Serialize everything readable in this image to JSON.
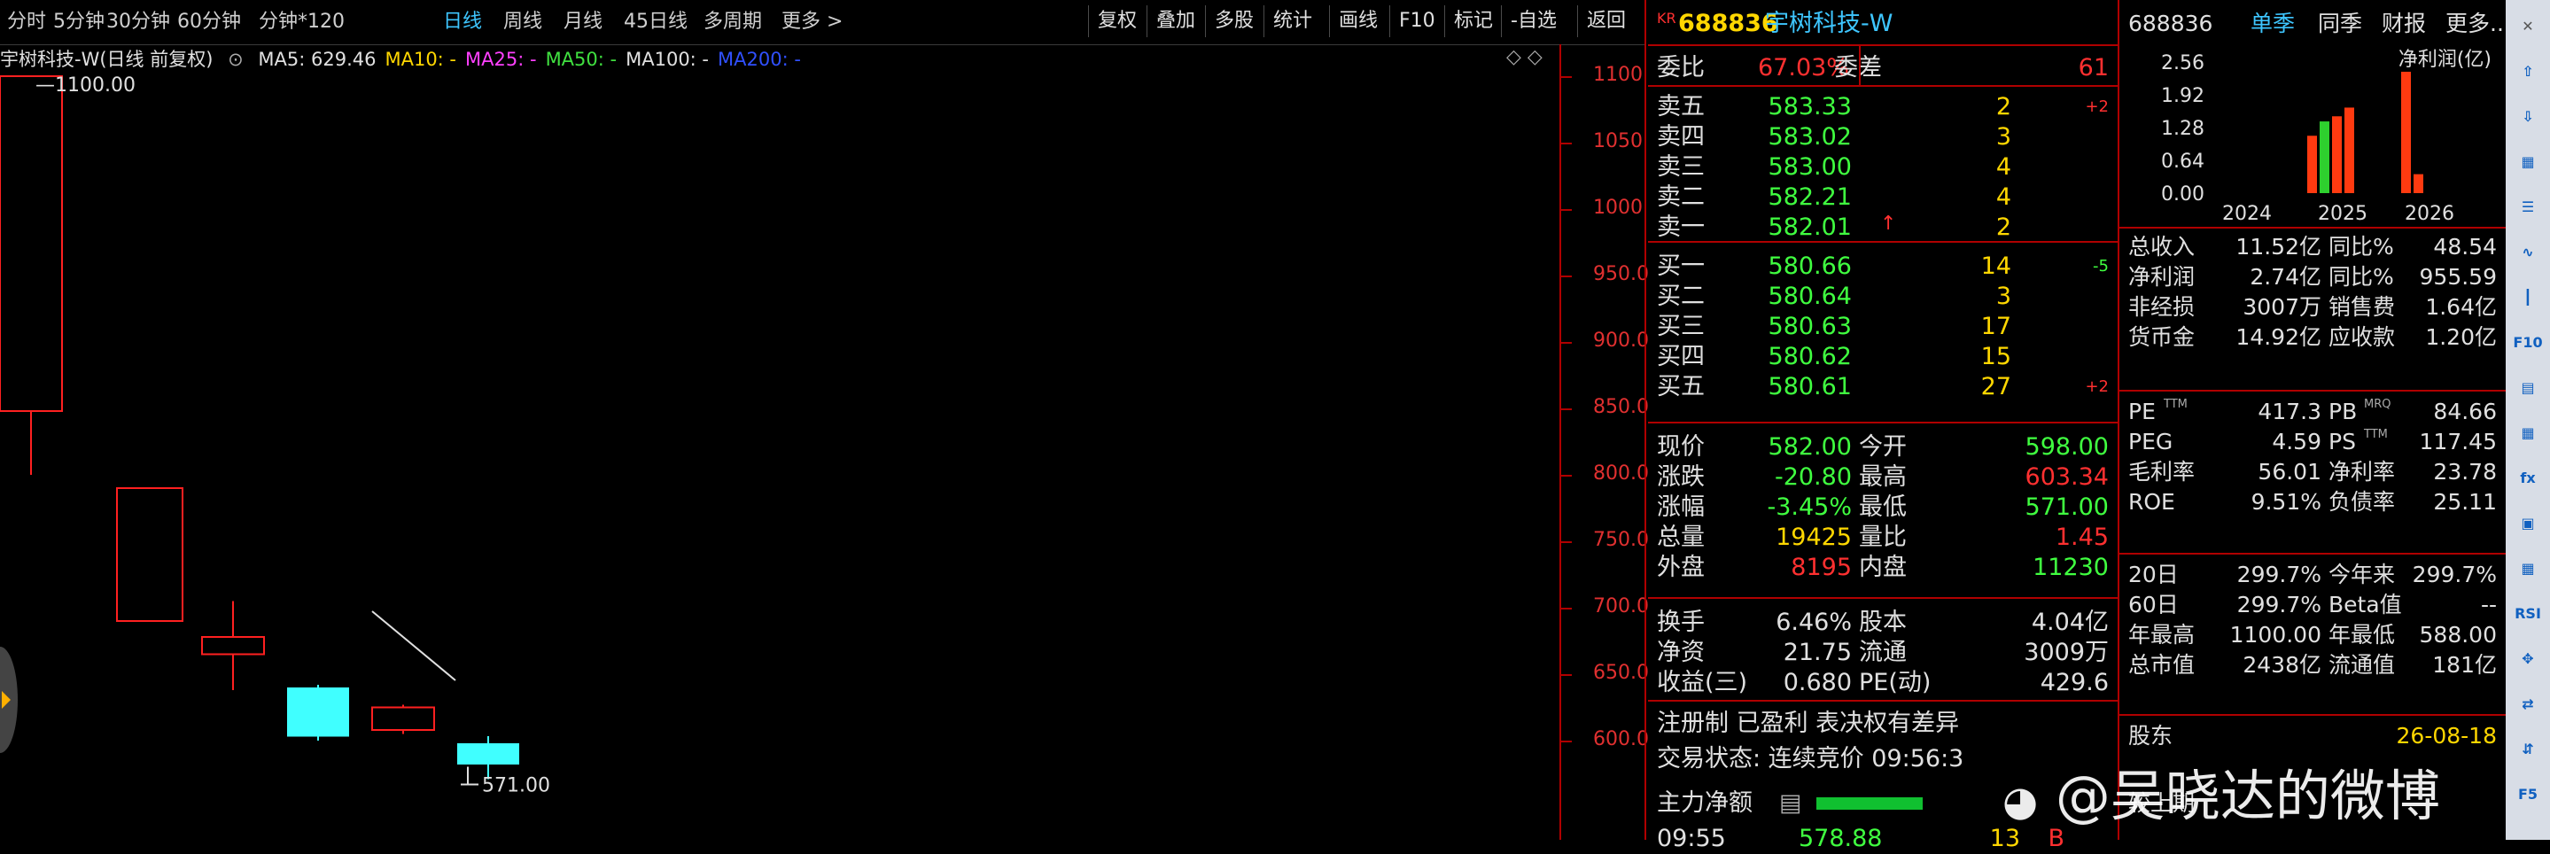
{
  "periods": [
    "分时",
    "5分钟",
    "30分钟",
    "60分钟",
    "分钟*120",
    "日线",
    "周线",
    "月线",
    "45日线",
    "多周期",
    "更多 >"
  ],
  "active_period": "日线",
  "tools": [
    "复权",
    "叠加",
    "多股",
    "统计",
    "画线",
    "F10",
    "标记",
    "-自选",
    "返回"
  ],
  "chart": {
    "title": "宇树科技-W(日线 前复权)",
    "ma": [
      {
        "label": "MA5: 629.46",
        "color": "#e0e0e0"
      },
      {
        "label": "MA10: -",
        "color": "#ffd700"
      },
      {
        "label": "MA25: -",
        "color": "#ff40ff"
      },
      {
        "label": "MA50: -",
        "color": "#40e040"
      },
      {
        "label": "MA100: -",
        "color": "#e0e0e0"
      },
      {
        "label": "MA200: -",
        "color": "#3050ff"
      }
    ],
    "high_label": "1100.00",
    "low_label": "571.00",
    "yticks": [
      "1100",
      "1050",
      "1000",
      "950.0",
      "900.0",
      "850.0",
      "800.0",
      "750.0",
      "700.0",
      "650.0",
      "600.0"
    ],
    "candles": [
      {
        "open": 848,
        "close": 1100,
        "high": 1100,
        "low": 800
      },
      {
        "open": 690,
        "close": 790,
        "high": 790,
        "low": 690
      },
      {
        "open": 665,
        "close": 678,
        "high": 705,
        "low": 638
      },
      {
        "open": 640,
        "close": 603,
        "high": 642,
        "low": 600
      },
      {
        "open": 608,
        "close": 625,
        "high": 627,
        "low": 605
      },
      {
        "open": 598,
        "close": 582,
        "high": 603.34,
        "low": 571
      }
    ]
  },
  "quote": {
    "badge": "KR",
    "code": "688836",
    "name": "宇树科技-W",
    "weibi_label": "委比",
    "weibi": "67.03%",
    "weicha_label": "委差",
    "weicha": "61",
    "sells": [
      {
        "label": "卖五",
        "price": "583.33",
        "vol": "2",
        "chg": "+2"
      },
      {
        "label": "卖四",
        "price": "583.02",
        "vol": "3",
        "chg": ""
      },
      {
        "label": "卖三",
        "price": "583.00",
        "vol": "4",
        "chg": ""
      },
      {
        "label": "卖二",
        "price": "582.21",
        "vol": "4",
        "chg": ""
      },
      {
        "label": "卖一",
        "price": "582.01",
        "vol": "2",
        "chg": ""
      }
    ],
    "buys": [
      {
        "label": "买一",
        "price": "580.66",
        "vol": "14",
        "chg": "-5"
      },
      {
        "label": "买二",
        "price": "580.64",
        "vol": "3",
        "chg": ""
      },
      {
        "label": "买三",
        "price": "580.63",
        "vol": "17",
        "chg": ""
      },
      {
        "label": "买四",
        "price": "580.62",
        "vol": "15",
        "chg": ""
      },
      {
        "label": "买五",
        "price": "580.61",
        "vol": "27",
        "chg": "+2"
      }
    ],
    "stats": [
      {
        "l1": "现价",
        "v1": "582.00",
        "c1": "#40ff40",
        "l2": "今开",
        "v2": "598.00",
        "c2": "#40ff40"
      },
      {
        "l1": "涨跌",
        "v1": "-20.80",
        "c1": "#40ff40",
        "l2": "最高",
        "v2": "603.34",
        "c2": "#ff3030"
      },
      {
        "l1": "涨幅",
        "v1": "-3.45%",
        "c1": "#40ff40",
        "l2": "最低",
        "v2": "571.00",
        "c2": "#40ff40"
      },
      {
        "l1": "总量",
        "v1": "19425",
        "c1": "#ffd700",
        "l2": "量比",
        "v2": "1.45",
        "c2": "#ff3030"
      },
      {
        "l1": "外盘",
        "v1": "8195",
        "c1": "#ff3030",
        "l2": "内盘",
        "v2": "11230",
        "c2": "#40ff40"
      }
    ],
    "stats2": [
      {
        "l1": "换手",
        "v1": "6.46%",
        "l2": "股本",
        "v2": "4.04亿"
      },
      {
        "l1": "净资",
        "v1": "21.75",
        "l2": "流通",
        "v2": "3009万"
      },
      {
        "l1": "收益(三)",
        "v1": "0.680",
        "l2": "PE(动)",
        "v2": "429.6"
      }
    ],
    "tags": "注册制 已盈利 表决权有差异",
    "trade_status": "交易状态: 连续竞价 09:56:3",
    "mainforce_label": "主力净额",
    "bottom_time": "09:55",
    "bottom_price": "578.88",
    "bottom_vol": "13",
    "bottom_flag": "B"
  },
  "fin": {
    "code": "688836",
    "tabs": [
      "单季",
      "同季",
      "财报",
      "更多.."
    ],
    "chart_title": "净利润(亿)",
    "yticks": [
      "2.56",
      "1.92",
      "1.28",
      "0.64",
      "0.00"
    ],
    "xticks": [
      "2024",
      "2025",
      "2026"
    ],
    "rows1": [
      {
        "l1": "总收入",
        "v1": "11.52亿",
        "l2": "同比%",
        "v2": "48.54"
      },
      {
        "l1": "净利润",
        "v1": "2.74亿",
        "l2": "同比%",
        "v2": "955.59"
      },
      {
        "l1": "非经损",
        "v1": "3007万",
        "l2": "销售费",
        "v2": "1.64亿"
      },
      {
        "l1": "货币金",
        "v1": "14.92亿",
        "l2": "应收款",
        "v2": "1.20亿"
      }
    ],
    "rows2": [
      {
        "l1": "PE",
        "s1": "TTM",
        "v1": "417.3",
        "l2": "PB",
        "s2": "MRQ",
        "v2": "84.66"
      },
      {
        "l1": "PEG",
        "s1": "",
        "v1": "4.59",
        "l2": "PS",
        "s2": "TTM",
        "v2": "117.45"
      },
      {
        "l1": "毛利率",
        "s1": "",
        "v1": "56.01",
        "l2": "净利率",
        "s2": "",
        "v2": "23.78"
      },
      {
        "l1": "ROE",
        "s1": "",
        "v1": "9.51%",
        "l2": "负债率",
        "s2": "",
        "v2": "25.11"
      }
    ],
    "rows3": [
      {
        "l1": "20日",
        "v1": "299.7%",
        "l2": "今年来",
        "v2": "299.7%"
      },
      {
        "l1": "60日",
        "v1": "299.7%",
        "l2": "Beta值",
        "v2": "--"
      },
      {
        "l1": "年最高",
        "v1": "1100.00",
        "l2": "年最低",
        "v2": "588.00"
      },
      {
        "l1": "总市值",
        "v1": "2438亿",
        "l2": "流通值",
        "v2": "181亿"
      }
    ],
    "gudong_label": "股东",
    "gudong_date": "26-08-18",
    "bottom_label": "较上期"
  },
  "watermark": "@吴晓达的微博",
  "chart_data": {
    "type": "bar",
    "title": "净利润(亿)",
    "categories": [
      "2024",
      "2025",
      "2026"
    ],
    "series": [
      {
        "values": [
          1.12,
          1.4,
          1.5,
          1.67,
          2.37,
          0.37
        ]
      }
    ],
    "ylim": [
      0,
      2.56
    ]
  }
}
